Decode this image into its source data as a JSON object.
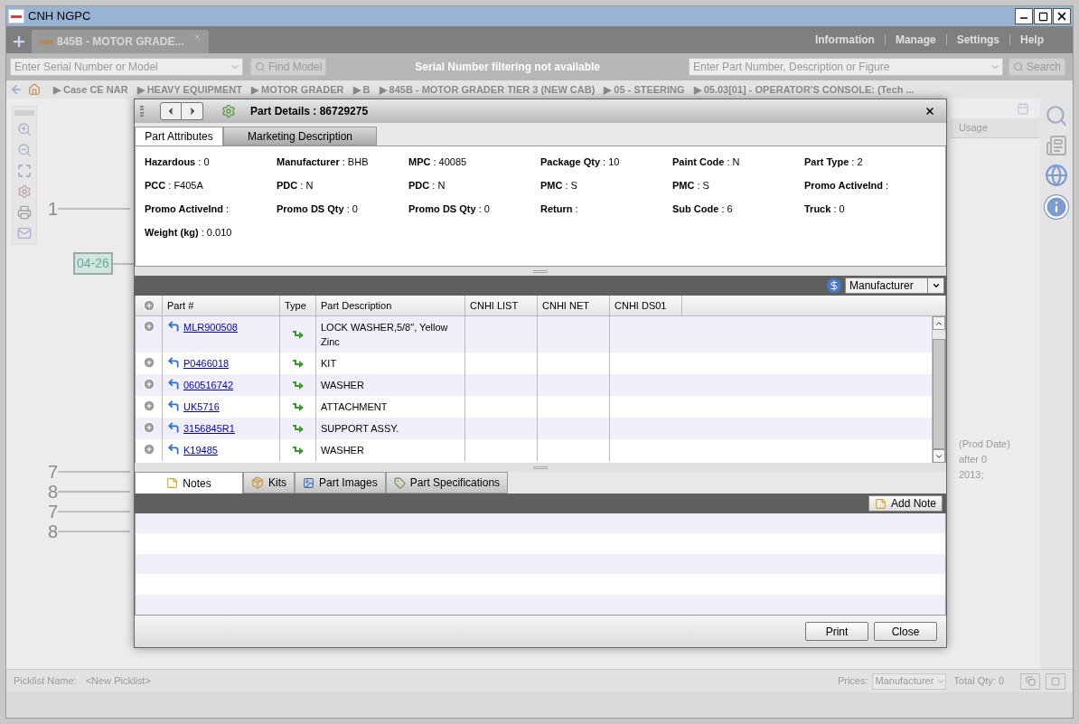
{
  "window": {
    "title": "CNH NGPC"
  },
  "top_tabs": [
    {
      "label": "845B - MOTOR GRADE...",
      "selected": true
    }
  ],
  "menu": [
    "Information",
    "Manage",
    "Settings",
    "Help"
  ],
  "serial_search": {
    "placeholder": "Enter Serial Number or Model",
    "button": "Find Model"
  },
  "filter_note": "Serial Number filtering not available",
  "part_search": {
    "placeholder": "Enter Part Number, Description or Figure",
    "button": "Search"
  },
  "breadcrumb": [
    "▶ Case CE NAR",
    "▶ HEAVY EQUIPMENT",
    "▶ MOTOR GRADER",
    "▶ B",
    "▶ 845B - MOTOR GRADER TIER 3 (NEW CAB)",
    "▶ 05 - STEERING",
    "▶ 05.03[01] - OPERATOR'S CONSOLE: (Tech ..."
  ],
  "diagram": {
    "callouts": [
      {
        "label": "1",
        "kind": "number"
      },
      {
        "label": "04-26",
        "kind": "tag"
      },
      {
        "label": "7",
        "kind": "number"
      },
      {
        "label": "8",
        "kind": "number"
      },
      {
        "label": "7",
        "kind": "number"
      },
      {
        "label": "8",
        "kind": "number"
      }
    ]
  },
  "usage_table": {
    "header": "Usage",
    "text": "(Prod Date) after 0\n2013;"
  },
  "dialog": {
    "title": "Part Details : 86729275",
    "tabs": [
      {
        "label": "Part Attributes",
        "selected": true
      },
      {
        "label": "Marketing Description",
        "selected": false
      }
    ],
    "attributes": [
      "**Hazardous** : 0",
      "**Manufacturer** : BHB",
      "**MPC** : 40085",
      "**Package Qty** : 10",
      "**Paint Code** : N",
      "**Part Type** : 2",
      "**PCC** : F405A",
      "**PDC** : N",
      "**PDC** : N",
      "**PMC** : S",
      "**PMC** : S",
      "**Promo ActiveInd** :",
      "**Promo ActiveInd** :",
      "**Promo DS Qty** : 0",
      "**Promo DS Qty** : 0",
      "**Return** :",
      "**Sub Code** : 6",
      "**Truck** : 0",
      "**Weight (kg)** : 0.010"
    ],
    "price_select": "Manufacturer",
    "columns": [
      "Part #",
      "Type",
      "Part Description",
      "CNHI LIST",
      "CNHI NET",
      "CNHI DS01"
    ],
    "rows": [
      {
        "part": "MLR900508",
        "description": "LOCK WASHER,5/8\", Yellow Zinc"
      },
      {
        "part": "P0466018",
        "description": "KIT"
      },
      {
        "part": "060516742",
        "description": "WASHER"
      },
      {
        "part": "UK5716",
        "description": "ATTACHMENT"
      },
      {
        "part": "3156845R1",
        "description": "SUPPORT ASSY."
      },
      {
        "part": "K19485",
        "description": "WASHER"
      }
    ],
    "bottom_tabs": [
      {
        "label": "Notes",
        "kind": "notes",
        "selected": true
      },
      {
        "label": "Kits",
        "kind": "kits",
        "selected": false
      },
      {
        "label": "Part Images",
        "kind": "images",
        "selected": false
      },
      {
        "label": "Part Specifications",
        "kind": "specs",
        "selected": false
      }
    ],
    "add_note": "Add Note",
    "buttons": [
      "Print",
      "Close"
    ]
  },
  "picklist": {
    "label": "Picklist Name:",
    "value": "<New Picklist>",
    "prices_label": "Prices:",
    "prices_value": "Manufacturer",
    "total": "Total Qty: 0"
  }
}
